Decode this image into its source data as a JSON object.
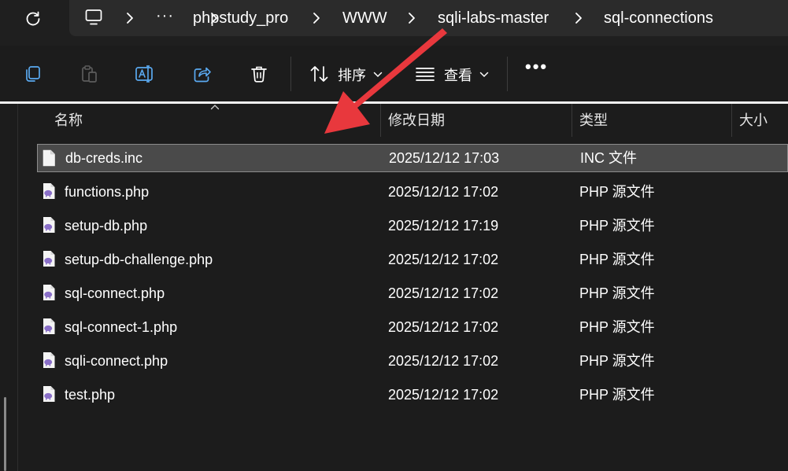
{
  "breadcrumb": {
    "more": "···",
    "items": [
      "phpstudy_pro",
      "WWW",
      "sqli-labs-master",
      "sql-connections"
    ]
  },
  "toolbar": {
    "sort_label": "排序",
    "view_label": "查看",
    "more_label": "•••"
  },
  "columns": {
    "name": "名称",
    "modified": "修改日期",
    "type": "类型",
    "size": "大小"
  },
  "files": [
    {
      "name": "db-creds.inc",
      "modified": "2025/12/12 17:03",
      "type": "INC 文件",
      "icon": "generic-file-icon",
      "selected": true
    },
    {
      "name": "functions.php",
      "modified": "2025/12/12 17:02",
      "type": "PHP 源文件",
      "icon": "php-file-icon",
      "selected": false
    },
    {
      "name": "setup-db.php",
      "modified": "2025/12/12 17:19",
      "type": "PHP 源文件",
      "icon": "php-file-icon",
      "selected": false
    },
    {
      "name": "setup-db-challenge.php",
      "modified": "2025/12/12 17:02",
      "type": "PHP 源文件",
      "icon": "php-file-icon",
      "selected": false
    },
    {
      "name": "sql-connect.php",
      "modified": "2025/12/12 17:02",
      "type": "PHP 源文件",
      "icon": "php-file-icon",
      "selected": false
    },
    {
      "name": "sql-connect-1.php",
      "modified": "2025/12/12 17:02",
      "type": "PHP 源文件",
      "icon": "php-file-icon",
      "selected": false
    },
    {
      "name": "sqli-connect.php",
      "modified": "2025/12/12 17:02",
      "type": "PHP 源文件",
      "icon": "php-file-icon",
      "selected": false
    },
    {
      "name": "test.php",
      "modified": "2025/12/12 17:02",
      "type": "PHP 源文件",
      "icon": "php-file-icon",
      "selected": false
    }
  ],
  "colors": {
    "background": "#1c1c1c",
    "address_bar": "#2b2b2b",
    "selected_row": "#4a4a4a",
    "annotation_arrow": "#e8383d",
    "php_icon_accent": "#8a6fc8"
  }
}
